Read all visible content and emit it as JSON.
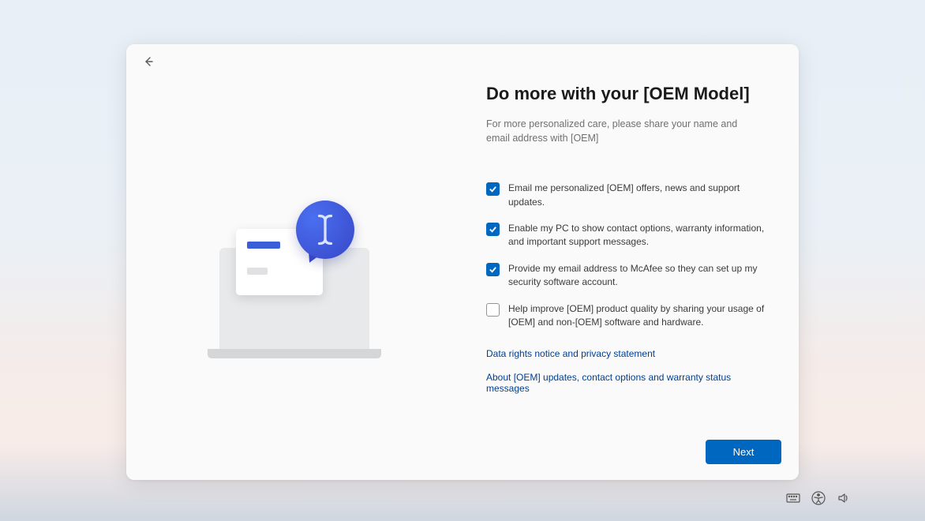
{
  "title": "Do more with your [OEM Model]",
  "subtitle": "For more personalized care, please share your name and email address with [OEM]",
  "options": [
    {
      "label": "Email me personalized [OEM] offers, news and support updates.",
      "checked": true
    },
    {
      "label": "Enable my PC to show contact options, warranty information, and important support messages.",
      "checked": true
    },
    {
      "label": "Provide my email address to McAfee so they can set up my security software account.",
      "checked": true
    },
    {
      "label": "Help improve [OEM]  product quality by sharing your usage of [OEM] and non-[OEM] software and hardware.",
      "checked": false
    }
  ],
  "links": {
    "privacy": "Data rights notice and privacy statement",
    "about": "About [OEM] updates, contact options and warranty status messages"
  },
  "buttons": {
    "next": "Next"
  }
}
